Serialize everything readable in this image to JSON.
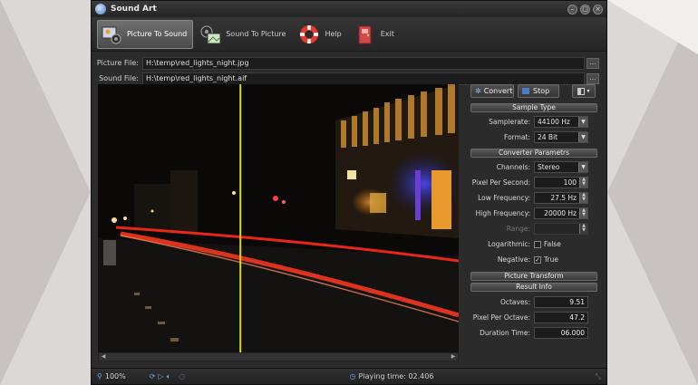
{
  "window": {
    "title": "Sound Art"
  },
  "toolbar": {
    "picture_to_sound": "Picture To Sound",
    "sound_to_picture": "Sound To Picture",
    "help": "Help",
    "exit": "Exit"
  },
  "files": {
    "picture_label": "Picture File:",
    "picture_value": "H:\\temp\\red_lights_night.jpg",
    "sound_label": "Sound File:",
    "sound_value": "H:\\temp\\red_lights_night.aif",
    "browse": "..."
  },
  "actions": {
    "convert": "Convert",
    "stop": "Stop"
  },
  "sample_type": {
    "header": "Sample Type",
    "samplerate_label": "Samplerate:",
    "samplerate": "44100 Hz",
    "format_label": "Format:",
    "format": "24 Bit"
  },
  "converter": {
    "header": "Converter Parametrs",
    "channels_label": "Channels:",
    "channels": "Stereo",
    "pps_label": "Pixel Per Second:",
    "pps": "100",
    "low_label": "Low Frequency:",
    "low": "27.5 Hz",
    "high_label": "High Frequency:",
    "high": "20000 Hz",
    "range_label": "Range:",
    "range": "",
    "log_label": "Logarithmic:",
    "log_value": "False",
    "neg_label": "Negative:",
    "neg_value": "True"
  },
  "picture_transform": {
    "header": "Picture Transform"
  },
  "result_info": {
    "header": "Result Info",
    "octaves_label": "Octaves:",
    "octaves": "9.51",
    "ppo_label": "Pixel Per Octave:",
    "ppo": "47.2",
    "duration_label": "Duration Time:",
    "duration": "06.000"
  },
  "status": {
    "zoom": "100%",
    "playing_time": "Playing time: 02.406"
  },
  "colors": {
    "cursor_line": "#d8d43a",
    "accent": "#4a7bc7"
  },
  "playback": {
    "cursor_position_fraction": 0.395
  }
}
